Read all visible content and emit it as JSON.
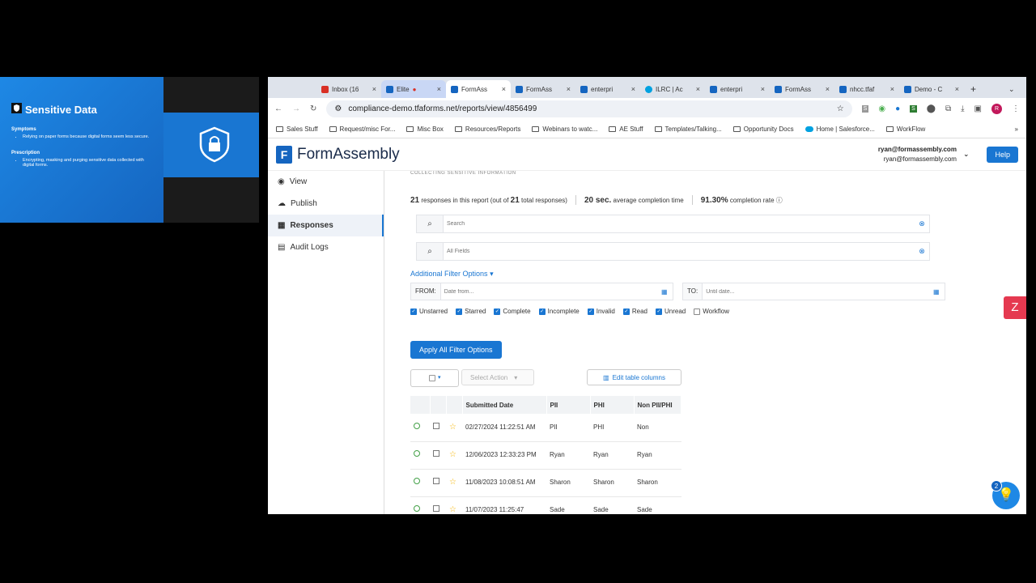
{
  "slide": {
    "title": "Sensitive Data",
    "symptoms_heading": "Symptoms",
    "symptoms": [
      "Relying on paper forms because digital forms seem less secure."
    ],
    "prescription_heading": "Prescription",
    "prescriptions": [
      "Encrypting, masking and purging sensitive data collected with digital forms."
    ]
  },
  "browser": {
    "tabs": [
      {
        "label": "Inbox (16"
      },
      {
        "label": "Elite"
      },
      {
        "label": "FormAss",
        "active": true
      },
      {
        "label": "FormAss"
      },
      {
        "label": "enterpri"
      },
      {
        "label": "ILRC | Ac"
      },
      {
        "label": "enterpri"
      },
      {
        "label": "FormAss"
      },
      {
        "label": "nhcc.tfaf"
      },
      {
        "label": "Demo - C"
      }
    ],
    "url": "compliance-demo.tfaforms.net/reports/view/4856499",
    "bookmarks": [
      "Sales Stuff",
      "Request/misc For...",
      "Misc Box",
      "Resources/Reports",
      "Webinars to watc...",
      "AE Stuff",
      "Templates/Talking...",
      "Opportunity Docs",
      "Home | Salesforce...",
      "WorkFlow"
    ]
  },
  "app": {
    "brand": "FormAssembly",
    "user_name": "ryan@formassembly.com",
    "user_email": "ryan@formassembly.com",
    "help_label": "Help",
    "nav": [
      {
        "label": "View"
      },
      {
        "label": "Publish"
      },
      {
        "label": "Responses",
        "active": true
      },
      {
        "label": "Audit Logs"
      }
    ],
    "crumb": "COLLECTING SENSITIVE INFORMATION",
    "stats": {
      "responses_count": "21",
      "responses_text": "responses in this report (out of",
      "total_count": "21",
      "total_text": "total responses)",
      "avg_time": "20 sec.",
      "avg_text": "average completion time",
      "rate": "91.30%",
      "rate_text": "completion rate"
    },
    "search_placeholder": "Search",
    "fields_placeholder": "All Fields",
    "additional_filter_label": "Additional Filter Options",
    "from_label": "FROM:",
    "from_placeholder": "Date from...",
    "to_label": "TO:",
    "to_placeholder": "Until date...",
    "filters": [
      {
        "label": "Unstarred",
        "checked": true
      },
      {
        "label": "Starred",
        "checked": true
      },
      {
        "label": "Complete",
        "checked": true
      },
      {
        "label": "Incomplete",
        "checked": true
      },
      {
        "label": "Invalid",
        "checked": true
      },
      {
        "label": "Read",
        "checked": true
      },
      {
        "label": "Unread",
        "checked": true
      },
      {
        "label": "Workflow",
        "checked": false
      }
    ],
    "apply_label": "Apply All Filter Options",
    "select_action_label": "Select Action",
    "edit_columns_label": "Edit table columns",
    "table": {
      "headers": [
        "",
        "",
        "",
        "Submitted Date",
        "PII",
        "PHI",
        "Non PII/PHI"
      ],
      "rows": [
        {
          "date": "02/27/2024 11:22:51 AM",
          "pii": "PII",
          "phi": "PHI",
          "non": "Non"
        },
        {
          "date": "12/06/2023 12:33:23 PM",
          "pii": "Ryan",
          "phi": "Ryan",
          "non": "Ryan"
        },
        {
          "date": "11/08/2023 10:08:51 AM",
          "pii": "Sharon",
          "phi": "Sharon",
          "non": "Sharon"
        },
        {
          "date": "11/07/2023 11:25:47",
          "pii": "Sade",
          "phi": "Sade",
          "non": "Sade"
        }
      ]
    },
    "help_badge": "2"
  }
}
